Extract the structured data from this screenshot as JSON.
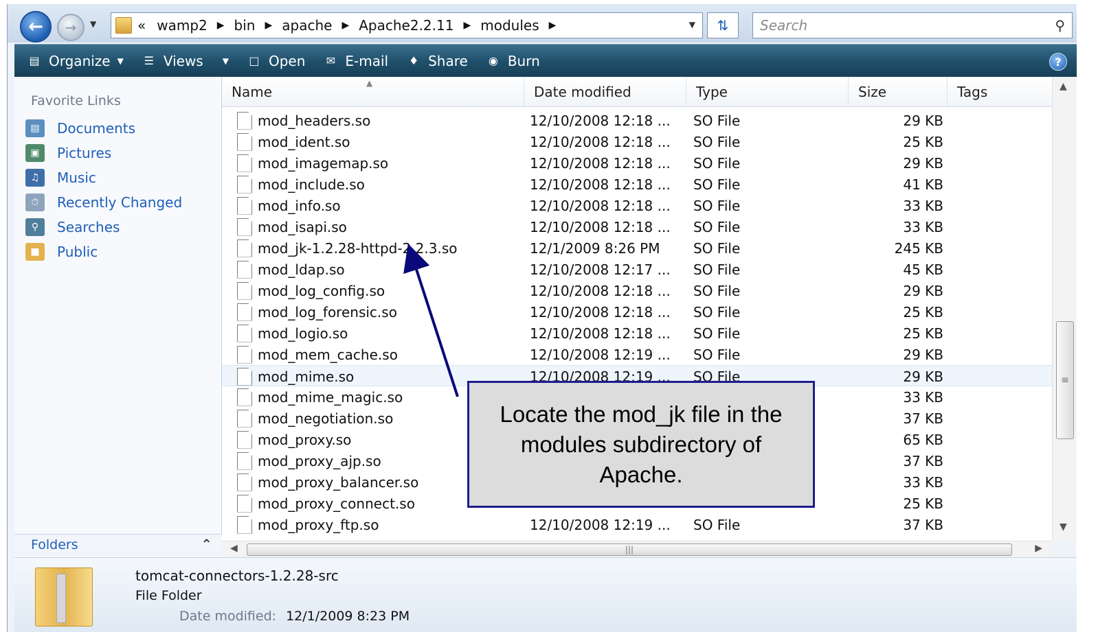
{
  "address": {
    "crumbs": [
      "«",
      "wamp2",
      "bin",
      "apache",
      "Apache2.2.11",
      "modules"
    ],
    "search_placeholder": "Search"
  },
  "toolbar": {
    "organize": "Organize",
    "views": "Views",
    "open": "Open",
    "email": "E-mail",
    "share": "Share",
    "burn": "Burn",
    "help": "?"
  },
  "nav": {
    "heading": "Favorite Links",
    "links": [
      "Documents",
      "Pictures",
      "Music",
      "Recently Changed",
      "Searches",
      "Public"
    ],
    "folders": "Folders"
  },
  "columns": [
    "Name",
    "Date modified",
    "Type",
    "Size",
    "Tags"
  ],
  "files": [
    {
      "name": "mod_headers.so",
      "date": "12/10/2008 12:18 ...",
      "type": "SO File",
      "size": "29 KB"
    },
    {
      "name": "mod_ident.so",
      "date": "12/10/2008 12:18 ...",
      "type": "SO File",
      "size": "25 KB"
    },
    {
      "name": "mod_imagemap.so",
      "date": "12/10/2008 12:18 ...",
      "type": "SO File",
      "size": "29 KB"
    },
    {
      "name": "mod_include.so",
      "date": "12/10/2008 12:18 ...",
      "type": "SO File",
      "size": "41 KB"
    },
    {
      "name": "mod_info.so",
      "date": "12/10/2008 12:18 ...",
      "type": "SO File",
      "size": "33 KB"
    },
    {
      "name": "mod_isapi.so",
      "date": "12/10/2008 12:18 ...",
      "type": "SO File",
      "size": "33 KB"
    },
    {
      "name": "mod_jk-1.2.28-httpd-2.2.3.so",
      "date": "12/1/2009 8:26 PM",
      "type": "SO File",
      "size": "245 KB"
    },
    {
      "name": "mod_ldap.so",
      "date": "12/10/2008 12:17 ...",
      "type": "SO File",
      "size": "45 KB"
    },
    {
      "name": "mod_log_config.so",
      "date": "12/10/2008 12:18 ...",
      "type": "SO File",
      "size": "29 KB"
    },
    {
      "name": "mod_log_forensic.so",
      "date": "12/10/2008 12:18 ...",
      "type": "SO File",
      "size": "25 KB"
    },
    {
      "name": "mod_logio.so",
      "date": "12/10/2008 12:18 ...",
      "type": "SO File",
      "size": "25 KB"
    },
    {
      "name": "mod_mem_cache.so",
      "date": "12/10/2008 12:19 ...",
      "type": "SO File",
      "size": "29 KB"
    },
    {
      "name": "mod_mime.so",
      "date": "12/10/2008 12:19 ...",
      "type": "SO File",
      "size": "29 KB"
    },
    {
      "name": "mod_mime_magic.so",
      "date": "",
      "type": "",
      "size": "33 KB"
    },
    {
      "name": "mod_negotiation.so",
      "date": "",
      "type": "",
      "size": "37 KB"
    },
    {
      "name": "mod_proxy.so",
      "date": "",
      "type": "",
      "size": "65 KB"
    },
    {
      "name": "mod_proxy_ajp.so",
      "date": "",
      "type": "",
      "size": "37 KB"
    },
    {
      "name": "mod_proxy_balancer.so",
      "date": "",
      "type": "",
      "size": "33 KB"
    },
    {
      "name": "mod_proxy_connect.so",
      "date": "",
      "type": "",
      "size": "25 KB"
    },
    {
      "name": "mod_proxy_ftp.so",
      "date": "12/10/2008 12:19 ...",
      "type": "SO File",
      "size": "37 KB"
    }
  ],
  "details": {
    "name": "tomcat-connectors-1.2.28-src",
    "type": "File Folder",
    "date_label": "Date modified:",
    "date_value": "12/1/2009 8:23 PM"
  },
  "callout": {
    "text": "Locate the mod_jk file in the modules subdirectory of Apache."
  },
  "colors": {
    "link": "#1f5fb8",
    "toolbar": "#1f4f6a",
    "callout_border": "#1d1d8f"
  }
}
